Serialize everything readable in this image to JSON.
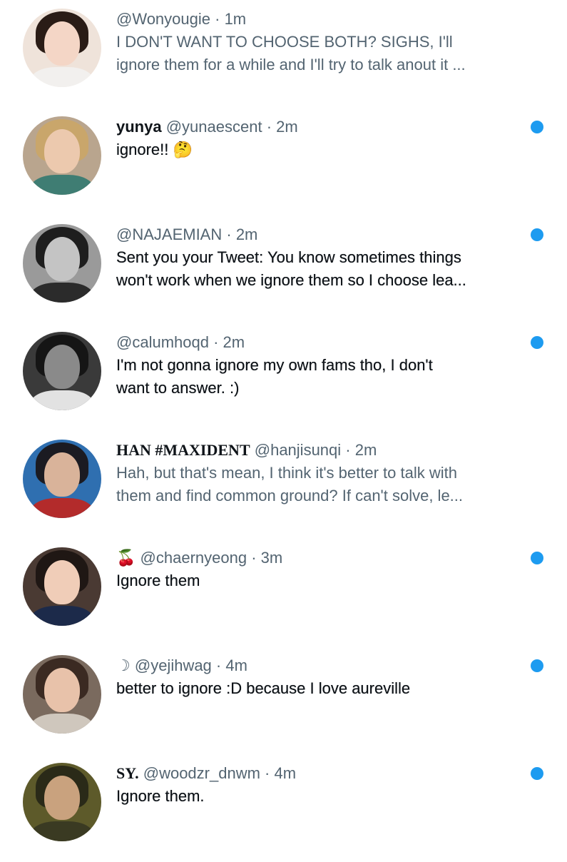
{
  "colors": {
    "accent": "#1d9bf0",
    "secondary_text": "#536471",
    "primary_text": "#0f1419"
  },
  "messages": [
    {
      "prefix": "",
      "name": "",
      "handle": "@Wonyougie",
      "sep": " · ",
      "time": "1m",
      "text": "I DON'T WANT TO CHOOSE BOTH? SIGHS, I'll\nignore them for a while and I'll try to talk anout it ...",
      "unread": false
    },
    {
      "prefix": "",
      "name": "yunya",
      "handle": "@yunaescent",
      "sep": " · ",
      "time": "2m",
      "text": "ignore!! 🤔",
      "unread": true
    },
    {
      "prefix": "",
      "name": "",
      "handle": "@NAJAEMIAN",
      "sep": " · ",
      "time": "2m",
      "text": "Sent you your Tweet: You know sometimes things\nwon't work when we ignore them so I choose lea...",
      "unread": true
    },
    {
      "prefix": "",
      "name": "",
      "handle": "@calumhoqd",
      "sep": " · ",
      "time": "2m",
      "text": "I'm not gonna ignore my own fams tho, I don't\nwant to answer. :)",
      "unread": true
    },
    {
      "prefix": "",
      "name": "HAN #MAXIDENT",
      "handle": "@hanjisunqi",
      "sep": " · ",
      "time": "2m",
      "text": "Hah, but that's mean, I think it's better to talk with\nthem and find common ground? If can't solve, le...",
      "unread": false
    },
    {
      "prefix": "🍒",
      "name": "",
      "handle": "@chaernyeong",
      "sep": " · ",
      "time": "3m",
      "text": "Ignore them",
      "unread": true
    },
    {
      "prefix": "☽",
      "name": "",
      "handle": "@yejihwag",
      "sep": " · ",
      "time": "4m",
      "text": "better to ignore :D because I love aureville",
      "unread": true
    },
    {
      "prefix": "",
      "name": "SY.",
      "handle": "@woodzr_dnwm",
      "sep": " · ",
      "time": "4m",
      "text": "Ignore them.",
      "unread": true
    }
  ]
}
